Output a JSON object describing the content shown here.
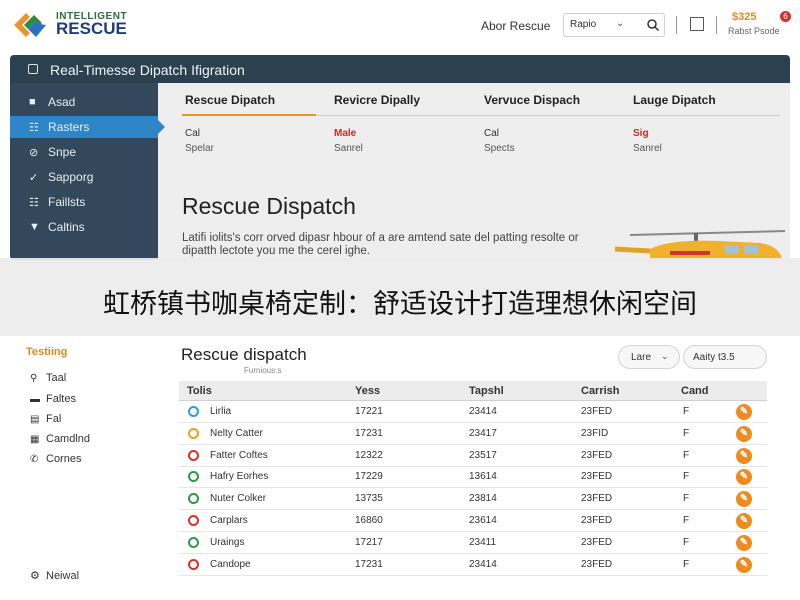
{
  "header": {
    "brand_top": "INTELLIGENT",
    "brand_main": "RESCUE",
    "about": "Abor Rescue",
    "select_value": "Rapio",
    "price": "$325",
    "badge": "6",
    "price_sub": "Rabst Psode",
    "logo_colors": [
      "#e7952a",
      "#2e8a46",
      "#2d6fc0"
    ]
  },
  "dispatch": {
    "title": "Real-Timesse Dipatch Ifigration",
    "sidebar": [
      {
        "icon": "■",
        "label": "Asad"
      },
      {
        "icon": "☷",
        "label": "Rasters",
        "active": true
      },
      {
        "icon": "⊘",
        "label": "Snpe"
      },
      {
        "icon": "✓",
        "label": "Sapporg"
      },
      {
        "icon": "☷",
        "label": "Faillsts"
      },
      {
        "icon": "▼",
        "label": "Caltins"
      }
    ],
    "tabs": [
      {
        "label": "Rescue Dipatch",
        "a": "Cal",
        "b": "Spelar",
        "red": false
      },
      {
        "label": "Revicre Dipally",
        "a": "Male",
        "b": "Sanrel",
        "red": true
      },
      {
        "label": "Vervuce Dispach",
        "a": "Cal",
        "b": "Spects",
        "red": false
      },
      {
        "label": "Lauge Dipatch",
        "a": "Sig",
        "b": "Sanrel",
        "red": true
      }
    ],
    "hero_title": "Rescue Dispatch",
    "hero_text": "Latifi iolits's corr orved dipasr hbour of a are amtend sate del patting resolte or dipatth lectote you me the cerel ighe."
  },
  "banner": {
    "text": "虹桥镇书咖桌椅定制：舒适设计打造理想休闲空间"
  },
  "lower_nav": {
    "heading": "Testiing",
    "items": [
      {
        "icon": "⚲",
        "label": "Taal"
      },
      {
        "icon": "▬",
        "label": "Faltes"
      },
      {
        "icon": "▤",
        "label": "Fal"
      },
      {
        "icon": "▦",
        "label": "Camdlnd"
      },
      {
        "icon": "✆",
        "label": "Cornes"
      }
    ],
    "footer_icon": "⚙",
    "footer": "Neiwal"
  },
  "table": {
    "title": "Rescue dispatch",
    "subtitle": "Furnious.s",
    "filter1": "Lare",
    "filter2": "Aaity t3.5",
    "columns": [
      "Tolis",
      "Yess",
      "Tapshl",
      "Carrish",
      "Cand"
    ],
    "rows": [
      {
        "color": "#2a9fd8",
        "name": "Lirlia",
        "c2": "17221",
        "c3": "23414",
        "c4": "23FED",
        "c5": "F"
      },
      {
        "color": "#e7a21e",
        "name": "Nelty Catter",
        "c2": "17231",
        "c3": "23417",
        "c4": "23FID",
        "c5": "F"
      },
      {
        "color": "#d0342c",
        "name": "Fatter Coftes",
        "c2": "12322",
        "c3": "23517",
        "c4": "23FED",
        "c5": "F"
      },
      {
        "color": "#2e9a46",
        "name": "Hafry Eorhes",
        "c2": "17229",
        "c3": "13614",
        "c4": "23FED",
        "c5": "F"
      },
      {
        "color": "#2e9a46",
        "name": "Nuter Colker",
        "c2": "13735",
        "c3": "23814",
        "c4": "23FED",
        "c5": "F"
      },
      {
        "color": "#d0342c",
        "name": "Carplars",
        "c2": "16860",
        "c3": "23614",
        "c4": "23FED",
        "c5": "F"
      },
      {
        "color": "#2e9a46",
        "name": "Uraings",
        "c2": "17217",
        "c3": "23411",
        "c4": "23FED",
        "c5": "F"
      },
      {
        "color": "#d0342c",
        "name": "Candope",
        "c2": "17231",
        "c3": "23414",
        "c4": "23FED",
        "c5": "F"
      }
    ],
    "action_icon": "✎"
  }
}
